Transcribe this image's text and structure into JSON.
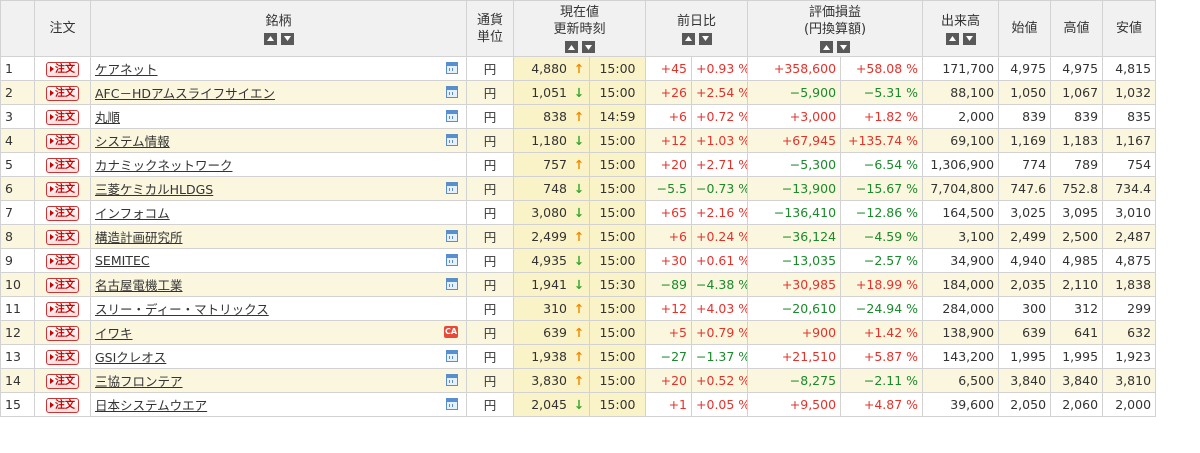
{
  "header": {
    "order": "注文",
    "name": "銘柄",
    "currency_l1": "通貨",
    "currency_l2": "単位",
    "price_l1": "現在値",
    "price_l2": "更新時刻",
    "change": "前日比",
    "pl_l1": "評価損益",
    "pl_l2": "(円換算額)",
    "volume": "出来高",
    "open": "始値",
    "high": "高値",
    "low": "安値"
  },
  "order_label": "注文",
  "colors": {
    "up": "#e4322b",
    "down": "#1a8a2a",
    "arrow_up": "#f08a00",
    "arrow_down": "#39a82a"
  },
  "rows": [
    {
      "no": "1",
      "name": "ケアネット",
      "icon": "calendar-icon",
      "currency": "円",
      "price": "4,880",
      "dir": "up",
      "time": "15:00",
      "chg": "+45",
      "chgp": "+0.93 %",
      "pl": "+358,600",
      "plp": "+58.08 %",
      "vol": "171,700",
      "open": "4,975",
      "high": "4,975",
      "low": "4,815"
    },
    {
      "no": "2",
      "name": "AFC－HDアムスライフサイエン",
      "icon": "calendar-icon",
      "currency": "円",
      "price": "1,051",
      "dir": "down",
      "time": "15:00",
      "chg": "+26",
      "chgp": "+2.54 %",
      "pl": "−5,900",
      "plp": "−5.31 %",
      "vol": "88,100",
      "open": "1,050",
      "high": "1,067",
      "low": "1,032"
    },
    {
      "no": "3",
      "name": "丸順",
      "icon": "calendar-icon",
      "currency": "円",
      "price": "838",
      "dir": "up",
      "time": "14:59",
      "chg": "+6",
      "chgp": "+0.72 %",
      "pl": "+3,000",
      "plp": "+1.82 %",
      "vol": "2,000",
      "open": "839",
      "high": "839",
      "low": "835"
    },
    {
      "no": "4",
      "name": "システム情報",
      "icon": "calendar-icon",
      "currency": "円",
      "price": "1,180",
      "dir": "down",
      "time": "15:00",
      "chg": "+12",
      "chgp": "+1.03 %",
      "pl": "+67,945",
      "plp": "+135.74 %",
      "vol": "69,100",
      "open": "1,169",
      "high": "1,183",
      "low": "1,167"
    },
    {
      "no": "5",
      "name": "カナミックネットワーク",
      "icon": "",
      "currency": "円",
      "price": "757",
      "dir": "up",
      "time": "15:00",
      "chg": "+20",
      "chgp": "+2.71 %",
      "pl": "−5,300",
      "plp": "−6.54 %",
      "vol": "1,306,900",
      "open": "774",
      "high": "789",
      "low": "754"
    },
    {
      "no": "6",
      "name": "三菱ケミカルHLDGS",
      "icon": "calendar-icon",
      "currency": "円",
      "price": "748",
      "dir": "down",
      "time": "15:00",
      "chg": "−5.5",
      "chgp": "−0.73 %",
      "pl": "−13,900",
      "plp": "−15.67 %",
      "vol": "7,704,800",
      "open": "747.6",
      "high": "752.8",
      "low": "734.4"
    },
    {
      "no": "7",
      "name": "インフォコム",
      "icon": "",
      "currency": "円",
      "price": "3,080",
      "dir": "down",
      "time": "15:00",
      "chg": "+65",
      "chgp": "+2.16 %",
      "pl": "−136,410",
      "plp": "−12.86 %",
      "vol": "164,500",
      "open": "3,025",
      "high": "3,095",
      "low": "3,010"
    },
    {
      "no": "8",
      "name": "構造計画研究所",
      "icon": "calendar-icon",
      "currency": "円",
      "price": "2,499",
      "dir": "up",
      "time": "15:00",
      "chg": "+6",
      "chgp": "+0.24 %",
      "pl": "−36,124",
      "plp": "−4.59 %",
      "vol": "3,100",
      "open": "2,499",
      "high": "2,500",
      "low": "2,487"
    },
    {
      "no": "9",
      "name": "SEMITEC",
      "icon": "calendar-icon",
      "currency": "円",
      "price": "4,935",
      "dir": "down",
      "time": "15:00",
      "chg": "+30",
      "chgp": "+0.61 %",
      "pl": "−13,035",
      "plp": "−2.57 %",
      "vol": "34,900",
      "open": "4,940",
      "high": "4,985",
      "low": "4,875"
    },
    {
      "no": "10",
      "name": "名古屋電機工業",
      "icon": "calendar-icon",
      "currency": "円",
      "price": "1,941",
      "dir": "down",
      "time": "15:30",
      "chg": "−89",
      "chgp": "−4.38 %",
      "pl": "+30,985",
      "plp": "+18.99 %",
      "vol": "184,000",
      "open": "2,035",
      "high": "2,110",
      "low": "1,838"
    },
    {
      "no": "11",
      "name": "スリー・ディー・マトリックス",
      "icon": "",
      "currency": "円",
      "price": "310",
      "dir": "up",
      "time": "15:00",
      "chg": "+12",
      "chgp": "+4.03 %",
      "pl": "−20,610",
      "plp": "−24.94 %",
      "vol": "284,000",
      "open": "300",
      "high": "312",
      "low": "299"
    },
    {
      "no": "12",
      "name": "イワキ",
      "icon": "ca-icon",
      "currency": "円",
      "price": "639",
      "dir": "up",
      "time": "15:00",
      "chg": "+5",
      "chgp": "+0.79 %",
      "pl": "+900",
      "plp": "+1.42 %",
      "vol": "138,900",
      "open": "639",
      "high": "641",
      "low": "632"
    },
    {
      "no": "13",
      "name": "GSIクレオス",
      "icon": "calendar-icon",
      "currency": "円",
      "price": "1,938",
      "dir": "up",
      "time": "15:00",
      "chg": "−27",
      "chgp": "−1.37 %",
      "pl": "+21,510",
      "plp": "+5.87 %",
      "vol": "143,200",
      "open": "1,995",
      "high": "1,995",
      "low": "1,923"
    },
    {
      "no": "14",
      "name": "三協フロンテア",
      "icon": "calendar-icon",
      "currency": "円",
      "price": "3,830",
      "dir": "up",
      "time": "15:00",
      "chg": "+20",
      "chgp": "+0.52 %",
      "pl": "−8,275",
      "plp": "−2.11 %",
      "vol": "6,500",
      "open": "3,840",
      "high": "3,840",
      "low": "3,810"
    },
    {
      "no": "15",
      "name": "日本システムウエア",
      "icon": "calendar-icon",
      "currency": "円",
      "price": "2,045",
      "dir": "down",
      "time": "15:00",
      "chg": "+1",
      "chgp": "+0.05 %",
      "pl": "+9,500",
      "plp": "+4.87 %",
      "vol": "39,600",
      "open": "2,050",
      "high": "2,060",
      "low": "2,000"
    }
  ]
}
